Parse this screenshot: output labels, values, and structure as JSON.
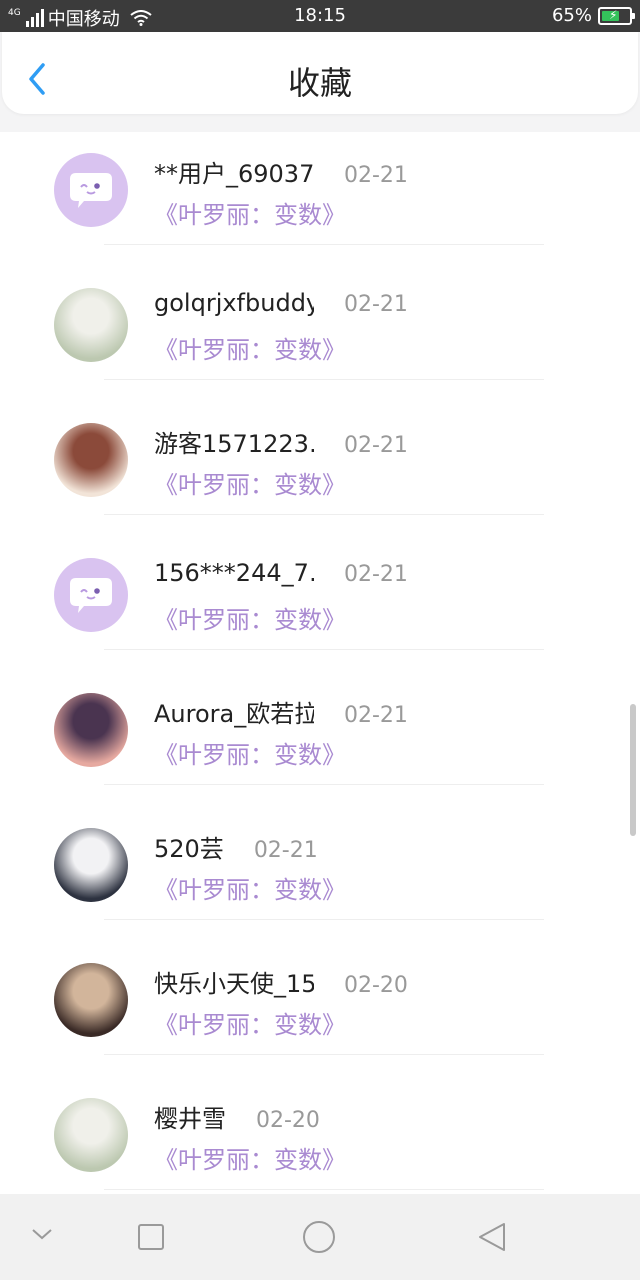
{
  "status_bar": {
    "network_tag": "4G",
    "carrier": "中国移动",
    "time": "18:15",
    "battery_pct": "65%",
    "battery_level": 0.65,
    "battery_color": "#34c25b"
  },
  "header": {
    "title": "收藏",
    "back_icon": "chevron-left-icon",
    "accent": "#2f9df4"
  },
  "favorites": [
    {
      "name": "**用户_69037…",
      "date": "02-21",
      "book": "《叶罗丽：变数》",
      "avatar": "default-chat-avatar"
    },
    {
      "name": "golqrjxfbuddyf",
      "date": "02-21",
      "book": "《叶罗丽：变数》",
      "avatar": "user-photo"
    },
    {
      "name": "游客1571223…",
      "date": "02-21",
      "book": "《叶罗丽：变数》",
      "avatar": "user-photo"
    },
    {
      "name": "156***244_7…",
      "date": "02-21",
      "book": "《叶罗丽：变数》",
      "avatar": "default-chat-avatar"
    },
    {
      "name": "Aurora_欧若拉",
      "date": "02-21",
      "book": "《叶罗丽：变数》",
      "avatar": "user-photo"
    },
    {
      "name": "520芸",
      "date": "02-21",
      "book": "《叶罗丽：变数》",
      "avatar": "user-photo"
    },
    {
      "name": "快乐小天使_15…",
      "date": "02-20",
      "book": "《叶罗丽：变数》",
      "avatar": "user-photo"
    },
    {
      "name": "樱井雪",
      "date": "02-20",
      "book": "《叶罗丽：变数》",
      "avatar": "user-photo"
    }
  ],
  "nav_bar": {
    "icons": [
      "chevron-down-icon",
      "square-icon",
      "circle-icon",
      "triangle-back-icon"
    ]
  }
}
